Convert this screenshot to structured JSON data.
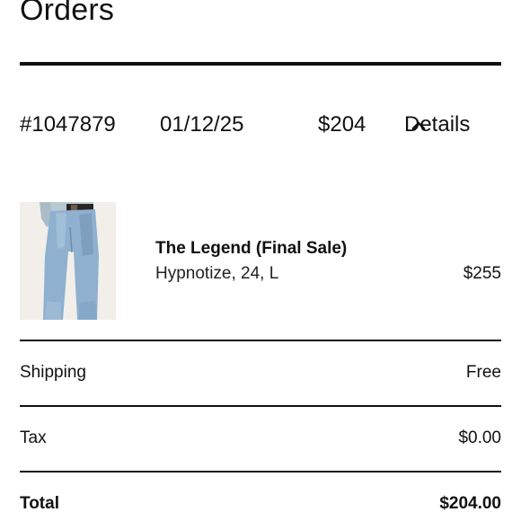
{
  "page": {
    "title": "Orders"
  },
  "order": {
    "number": "#1047879",
    "date": "01/12/25",
    "amount": "$204",
    "details_label": "Details",
    "details_icon": "chevron-up-icon"
  },
  "item": {
    "name": "The Legend (Final Sale)",
    "variant": "Hypnotize, 24, L",
    "price": "$255",
    "image": "jeans-photo"
  },
  "summary": {
    "shipping_label": "Shipping",
    "shipping_value": "Free",
    "tax_label": "Tax",
    "tax_value": "$0.00",
    "total_label": "Total",
    "total_value": "$204.00"
  },
  "colors": {
    "text": "#111111",
    "background": "#ffffff",
    "denim": "#8fb0cf"
  }
}
